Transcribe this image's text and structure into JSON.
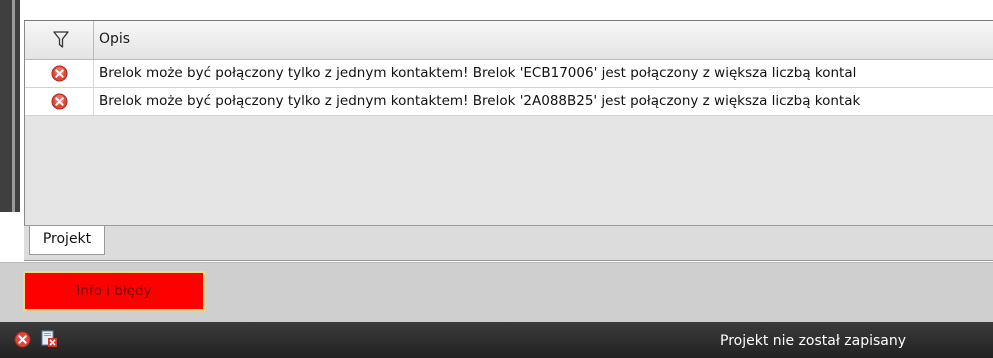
{
  "grid": {
    "columns": {
      "description": "Opis"
    },
    "rows": [
      {
        "icon": "error-icon",
        "description": "Brelok może być połączony tylko z jednym kontaktem! Brelok 'ECB17006' jest połączony z większa liczbą kontal"
      },
      {
        "icon": "error-icon",
        "description": "Brelok może być połączony tylko z jednym kontaktem! Brelok '2A088B25' jest połączony z większa liczbą kontak"
      }
    ]
  },
  "tabs": [
    {
      "label": "Projekt"
    }
  ],
  "info_button": {
    "label": "Info i błędy",
    "color": "#ff0000"
  },
  "statusbar": {
    "icons": [
      "error-icon",
      "document-error-icon"
    ],
    "message": "Projekt nie został zapisany"
  },
  "colors": {
    "error": "#e0473a",
    "status_bar": "#2f2f2f"
  }
}
